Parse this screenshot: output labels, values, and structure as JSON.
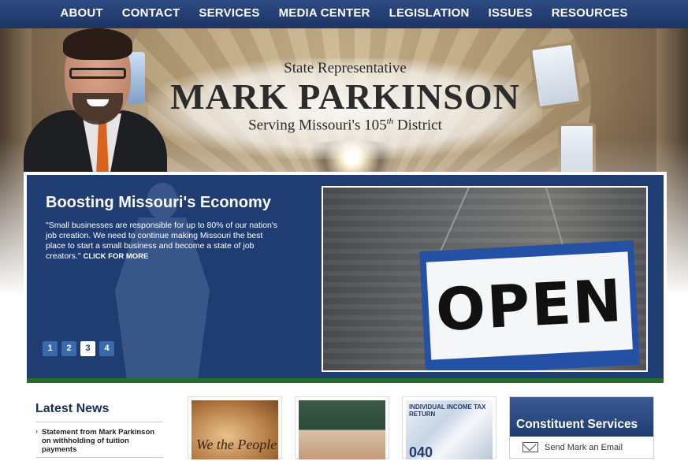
{
  "nav": {
    "items": [
      "ABOUT",
      "CONTACT",
      "SERVICES",
      "MEDIA CENTER",
      "LEGISLATION",
      "ISSUES",
      "RESOURCES"
    ]
  },
  "header": {
    "subtitle": "State Representative",
    "name": "MARK PARKINSON",
    "district_prefix": "Serving Missouri's 105",
    "district_suffix": "th",
    "district_tail": " District"
  },
  "slider": {
    "title": "Boosting Missouri's Economy",
    "quote": "\"Small businesses are responsible for up to 80% of our nation's job creation. We need to continue making Missouri the best place to start a small business and become a state of job creators.\"",
    "more_label": "CLICK FOR MORE",
    "pages": [
      "1",
      "2",
      "3",
      "4"
    ],
    "active_page": 3,
    "photo_sign_text": "OPEN"
  },
  "news": {
    "heading": "Latest News",
    "items": [
      "Statement from Mark Parkinson on withholding of tuition payments"
    ]
  },
  "thumbnails": {
    "t1_text": "We the People",
    "t3_text_top": "INDIVIDUAL INCOME TAX RETURN",
    "t3_text_big": "040"
  },
  "constituent": {
    "heading": "Constituent Services",
    "email_label": "Send Mark an Email"
  },
  "colors": {
    "nav_bg": "#1d3566",
    "slide_bg": "#1f3d72",
    "pager_bg": "#3b6aaa",
    "accent_green": "#2a6a2a"
  }
}
